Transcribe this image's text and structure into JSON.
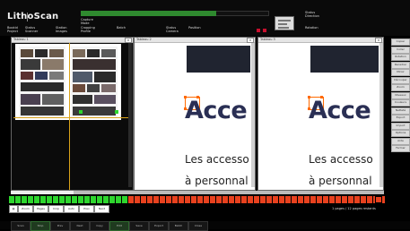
{
  "header": {
    "logo": "LithoScan",
    "progress_fraction": 0.72,
    "fields_col1": [
      "Bookid",
      "Project",
      "Status",
      "Scanner",
      "Station",
      "Images"
    ],
    "fields_col2": [
      "Capture",
      "Mode",
      "Cropping",
      "Profile",
      "Batch"
    ],
    "fields_col3": [
      "Status",
      "Camera",
      "Position"
    ],
    "fields_col4": [
      "Status",
      "Direction",
      "Rotation"
    ],
    "status_left_color": "#c8102e",
    "status_right_color": "#c8102e"
  },
  "panels": {
    "panel1_title": "Tableau 1",
    "panel2_title": "Tableau 2",
    "panel3_title": "Tableau 3"
  },
  "page_left": {
    "headline": "Acce",
    "line1": "Les accesso",
    "line2": "à personnal"
  },
  "page_right": {
    "headline": "Acce",
    "line1": "Les accesso",
    "line2": "à personnal"
  },
  "right_column": {
    "buttons": [
      "Copier",
      "Coller",
      "Rotation",
      "Recadrer",
      "Miroir",
      "Découper",
      "Zoom",
      "Niveaux",
      "Couleurs",
      "Netteté",
      "Export",
      "Import",
      "Options",
      "Aide",
      "Fermer"
    ]
  },
  "cellbar": {
    "states": [
      "g",
      "g",
      "g",
      "g",
      "g",
      "g",
      "g",
      "g",
      "g",
      "g",
      "g",
      "g",
      "g",
      "g",
      "g",
      "g",
      "g",
      "g",
      "g",
      "r",
      "r",
      "r",
      "r",
      "r",
      "r",
      "r",
      "r",
      "r",
      "r",
      "r",
      "r",
      "r",
      "r",
      "r",
      "r",
      "r",
      "r",
      "r",
      "r",
      "r",
      "r",
      "r",
      "r",
      "r",
      "r",
      "r",
      "r",
      "r",
      "r",
      "r",
      "r",
      "r",
      "r",
      "r",
      "r",
      "r",
      "r",
      "r",
      "r",
      "r"
    ],
    "green": "#2ed62e",
    "red": "#e8411e"
  },
  "toolbar": {
    "items": [
      "▤",
      "Zoom",
      "Pages",
      "Crop",
      "Auto",
      "Prev",
      "Next"
    ]
  },
  "bottom_status": "1 pages / 12 pages restants",
  "footer": {
    "buttons": [
      "Scan",
      "Stop",
      "Prev",
      "Next",
      "Copy",
      "Edit",
      "Save",
      "Export",
      "Batch",
      "Close"
    ]
  },
  "accent": "#ff6a00"
}
